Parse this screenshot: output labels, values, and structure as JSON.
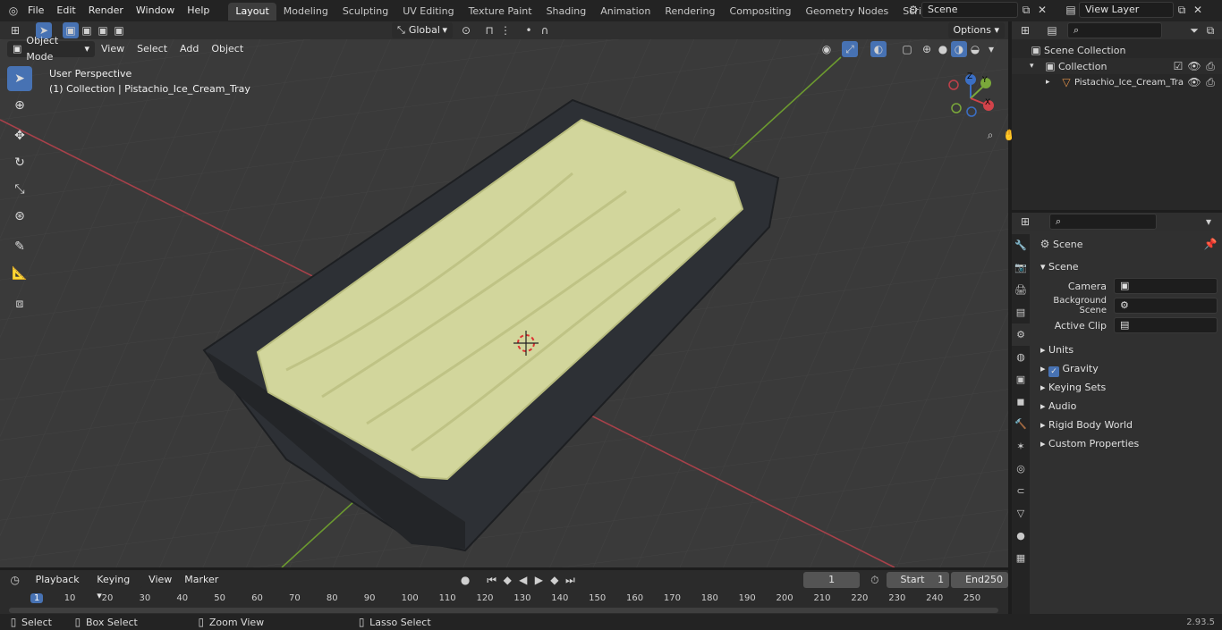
{
  "top_menu": [
    "File",
    "Edit",
    "Render",
    "Window",
    "Help"
  ],
  "workspaces": [
    "Layout",
    "Modeling",
    "Sculpting",
    "UV Editing",
    "Texture Paint",
    "Shading",
    "Animation",
    "Rendering",
    "Compositing",
    "Geometry Nodes",
    "Scripting"
  ],
  "scene_name": "Scene",
  "view_layer": "View Layer",
  "editor_header": {
    "transform": "Global",
    "options": "Options"
  },
  "viewport_header": {
    "mode": "Object Mode",
    "menus": [
      "View",
      "Select",
      "Add",
      "Object"
    ]
  },
  "overlay": {
    "perspective": "User Perspective",
    "collection": "(1) Collection | Pistachio_Ice_Cream_Tray"
  },
  "gizmo": {
    "z": "Z",
    "y": "Y",
    "x": "X"
  },
  "outliner": {
    "root": "Scene Collection",
    "collection": "Collection",
    "object": "Pistachio_Ice_Cream_Tra"
  },
  "properties": {
    "breadcrumb": "Scene",
    "section": "Scene",
    "camera_label": "Camera",
    "bg_label": "Background Scene",
    "clip_label": "Active Clip",
    "panels": [
      "Units",
      "Gravity",
      "Keying Sets",
      "Audio",
      "Rigid Body World",
      "Custom Properties"
    ]
  },
  "timeline": {
    "menus": [
      "Playback",
      "Keying",
      "View",
      "Marker"
    ],
    "current_frame": "1",
    "start_label": "Start",
    "start": "1",
    "end_label": "End",
    "end": "250",
    "ticks": [
      "1",
      "10",
      "20",
      "30",
      "40",
      "50",
      "60",
      "70",
      "80",
      "90",
      "100",
      "110",
      "120",
      "130",
      "140",
      "150",
      "160",
      "170",
      "180",
      "190",
      "200",
      "210",
      "220",
      "230",
      "240",
      "250"
    ]
  },
  "status": {
    "select": "Select",
    "box_select": "Box Select",
    "zoom_view": "Zoom View",
    "lasso": "Lasso Select",
    "version": "2.93.5"
  },
  "colors": {
    "accent": "#4772b3",
    "x_axis": "#c0404a",
    "y_axis": "#6c9a2f",
    "ice_cream": "#d6dba3",
    "tray": "#2e3136"
  }
}
